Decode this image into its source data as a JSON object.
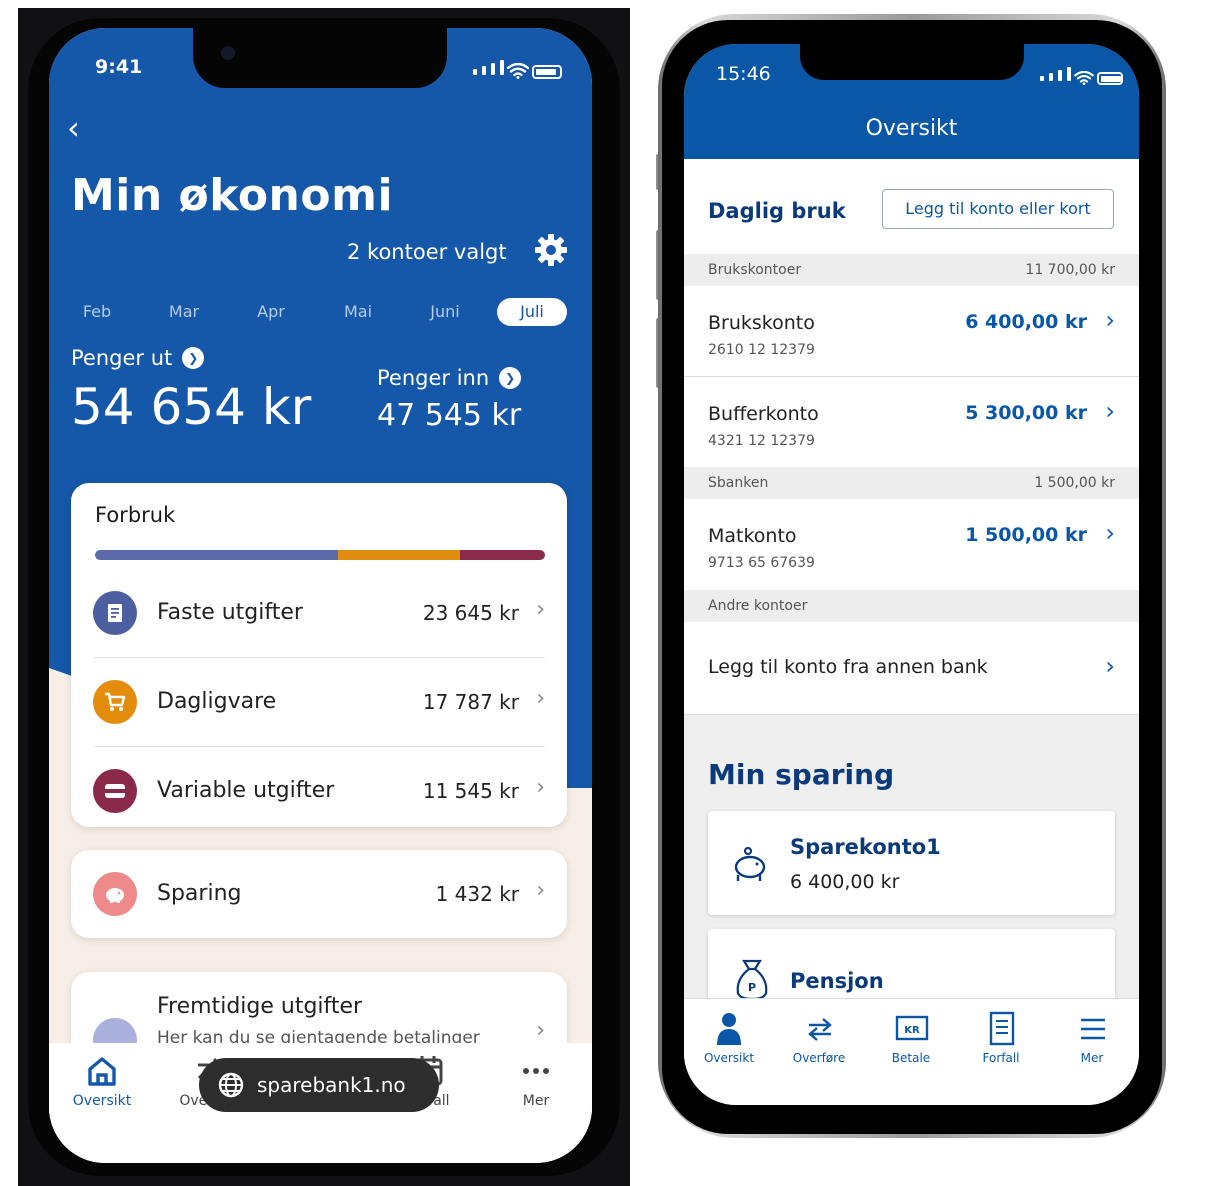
{
  "left": {
    "status_time": "9:41",
    "title": "Min økonomi",
    "accounts_selected": "2 kontoer valgt",
    "months": [
      "Feb",
      "Mar",
      "Apr",
      "Mai",
      "Juni",
      "Juli"
    ],
    "active_month": "Juli",
    "money_out_label": "Penger ut",
    "money_out_value": "54 654 kr",
    "money_in_label": "Penger inn",
    "money_in_value": "47 545 kr",
    "spending_title": "Forbruk",
    "spending_bar": [
      {
        "share": 0.54,
        "color": "#5b6aa8"
      },
      {
        "share": 0.27,
        "color": "#e08c10"
      },
      {
        "share": 0.19,
        "color": "#8c2a4a"
      }
    ],
    "spending_rows": [
      {
        "label": "Faste utgifter",
        "value": "23 645 kr",
        "color": "#4c5fa0",
        "icon": "receipt-icon"
      },
      {
        "label": "Dagligvare",
        "value": "17 787 kr",
        "color": "#e48d0c",
        "icon": "cart-icon"
      },
      {
        "label": "Variable utgifter",
        "value": "11 545 kr",
        "color": "#8b2a48",
        "icon": "card-icon"
      }
    ],
    "savings": {
      "label": "Sparing",
      "value": "1 432 kr",
      "color": "#ef8a8a",
      "icon": "piggy-icon"
    },
    "future": {
      "title": "Fremtidige utgifter",
      "subtitle": "Her kan du se gjentagende betalinger"
    },
    "nav": [
      {
        "label": "Oversikt",
        "icon": "home-icon"
      },
      {
        "label": "Overføre",
        "icon": "transfer-icon"
      },
      {
        "label": "",
        "icon": "wallet-icon"
      },
      {
        "label": "Forfall",
        "icon": "calendar-icon"
      },
      {
        "label": "Mer",
        "icon": "more-icon"
      }
    ],
    "url_pill": "sparebank1.no"
  },
  "right": {
    "status_time": "15:46",
    "title": "Oversikt",
    "daily_title": "Daglig bruk",
    "add_account_button": "Legg til konto eller kort",
    "sections": [
      {
        "name": "Brukskontoer",
        "total": "11 700,00 kr"
      },
      {
        "name": "Sbanken",
        "total": "1 500,00 kr"
      },
      {
        "name": "Andre kontoer",
        "total": ""
      }
    ],
    "accounts": [
      {
        "name": "Brukskonto",
        "number": "2610 12 12379",
        "amount": "6 400,00 kr"
      },
      {
        "name": "Bufferkonto",
        "number": "4321 12 12379",
        "amount": "5 300,00 kr"
      },
      {
        "name": "Matkonto",
        "number": "9713 65 67639",
        "amount": "1 500,00 kr"
      }
    ],
    "add_other_bank": "Legg til konto fra annen bank",
    "savings_title": "Min sparing",
    "savings_cards": [
      {
        "name": "Sparekonto1",
        "amount": "6 400,00 kr",
        "icon": "piggy-bank-icon"
      },
      {
        "name": "Pensjon",
        "amount": "",
        "icon": "money-bag-icon"
      }
    ],
    "nav": [
      {
        "label": "Oversikt",
        "icon": "person-icon"
      },
      {
        "label": "Overføre",
        "icon": "transfer-icon"
      },
      {
        "label": "Betale",
        "icon": "kr-card-icon"
      },
      {
        "label": "Forfall",
        "icon": "document-icon"
      },
      {
        "label": "Mer",
        "icon": "menu-icon"
      }
    ]
  }
}
